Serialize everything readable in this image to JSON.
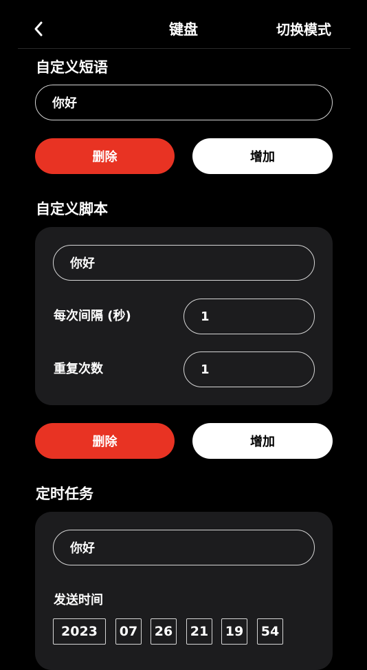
{
  "header": {
    "title": "键盘",
    "switch_mode": "切换模式"
  },
  "phrase": {
    "title": "自定义短语",
    "input_value": "你好",
    "delete_label": "删除",
    "add_label": "增加"
  },
  "script": {
    "title": "自定义脚本",
    "input_value": "你好",
    "interval_label": "每次间隔 (秒)",
    "interval_value": "1",
    "repeat_label": "重复次数",
    "repeat_value": "1",
    "delete_label": "删除",
    "add_label": "增加"
  },
  "timer": {
    "title": "定时任务",
    "input_value": "你好",
    "send_time_label": "发送时间",
    "year": "2023",
    "month": "07",
    "day": "26",
    "hour": "21",
    "minute": "19",
    "second": "54"
  },
  "colors": {
    "background": "#000000",
    "card": "#1c1c1e",
    "accent_red": "#e83323",
    "button_white": "#ffffff"
  }
}
